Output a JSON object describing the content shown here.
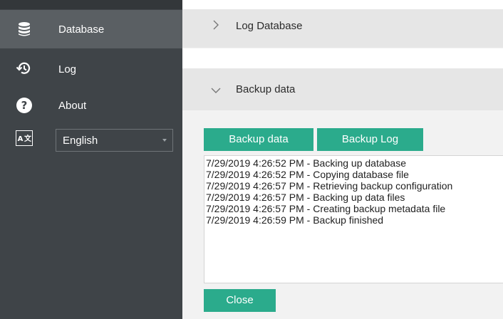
{
  "sidebar": {
    "items": [
      {
        "label": "Database",
        "icon": "database-icon",
        "active": true
      },
      {
        "label": "Log",
        "icon": "history-icon",
        "active": false
      },
      {
        "label": "About",
        "icon": "help-icon",
        "active": false
      }
    ],
    "language": {
      "icon": "translate-icon",
      "selected": "English"
    }
  },
  "sections": {
    "log_database": {
      "title": "Log Database",
      "expanded": false
    },
    "backup_data": {
      "title": "Backup data",
      "expanded": true
    }
  },
  "backup": {
    "backup_data_button": "Backup data",
    "backup_log_button": "Backup Log",
    "close_button": "Close",
    "log_lines": [
      "7/29/2019 4:26:52 PM - Backing up database",
      "7/29/2019 4:26:52 PM - Copying database file",
      "7/29/2019 4:26:57 PM - Retrieving backup configuration",
      "7/29/2019 4:26:57 PM - Backing up data files",
      "7/29/2019 4:26:57 PM - Creating backup metadata file",
      "7/29/2019 4:26:59 PM - Backup finished"
    ]
  },
  "colors": {
    "sidebar": "#3f4448",
    "sidebar_active": "#5a5f63",
    "accent": "#2bab8c",
    "section_header": "#e6e6e6",
    "panel": "#f2f2f2"
  }
}
